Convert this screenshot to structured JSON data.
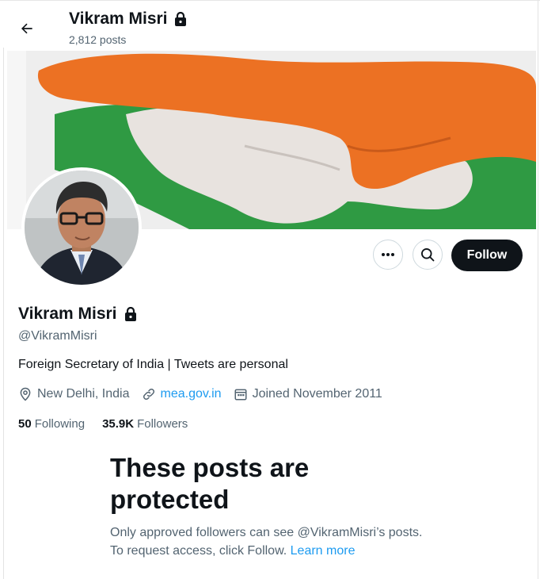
{
  "header": {
    "name": "Vikram Misri",
    "posts_count": "2,812 posts"
  },
  "profile": {
    "display_name": "Vikram Misri",
    "handle": "@VikramMisri",
    "bio": "Foreign Secretary of India | Tweets are personal",
    "location": "New Delhi, India",
    "website": "mea.gov.in",
    "joined": "Joined November 2011",
    "following_count": "50",
    "following_label": "Following",
    "followers_count": "35.9K",
    "followers_label": "Followers"
  },
  "actions": {
    "follow_label": "Follow"
  },
  "protected": {
    "title": "These posts are protected",
    "text": "Only approved followers can see @VikramMisri’s posts. To request access, click Follow.",
    "learn_more": "Learn more"
  },
  "colors": {
    "accent": "#1d9bf0",
    "text_primary": "#0f1419",
    "text_secondary": "#536471",
    "follow_button": "#0f1419"
  },
  "icons": [
    "back-arrow-icon",
    "lock-icon",
    "more-icon",
    "search-icon",
    "location-icon",
    "link-icon",
    "calendar-icon"
  ]
}
